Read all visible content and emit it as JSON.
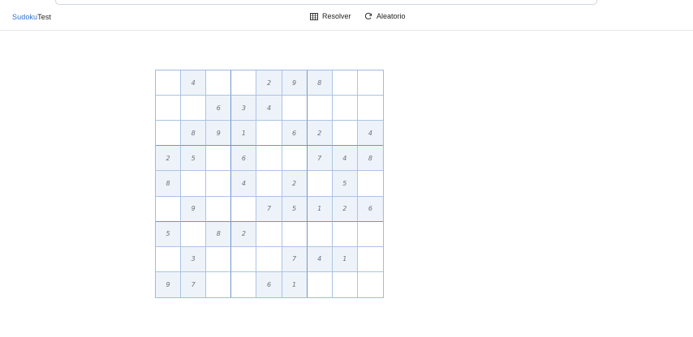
{
  "brand": {
    "part1": "Sudoku",
    "part2": "Test"
  },
  "nav": {
    "resolver": {
      "label": "Resolver",
      "icon": "grid-icon"
    },
    "aleatorio": {
      "label": "Aleatorio",
      "icon": "refresh-icon"
    }
  },
  "colors": {
    "brand_accent": "#2f6fd1",
    "given_cell_bg": "#eef3fa",
    "grid_line": "#aac4e4",
    "box_line": "#6f97c8"
  },
  "board": {
    "rows": [
      [
        "",
        "4",
        "",
        "",
        "2",
        "9",
        "8",
        "",
        ""
      ],
      [
        "",
        "",
        "6",
        "3",
        "4",
        "",
        "",
        "",
        ""
      ],
      [
        "",
        "8",
        "9",
        "1",
        "",
        "6",
        "2",
        "",
        "4"
      ],
      [
        "2",
        "5",
        "",
        "6",
        "",
        "",
        "7",
        "4",
        "8"
      ],
      [
        "8",
        "",
        "",
        "4",
        "",
        "2",
        "",
        "5",
        ""
      ],
      [
        "",
        "9",
        "",
        "",
        "7",
        "5",
        "1",
        "2",
        "6"
      ],
      [
        "5",
        "",
        "8",
        "2",
        "",
        "",
        "",
        "",
        ""
      ],
      [
        "",
        "3",
        "",
        "",
        "",
        "7",
        "4",
        "1",
        ""
      ],
      [
        "9",
        "7",
        "",
        "",
        "6",
        "1",
        "",
        "",
        ""
      ]
    ]
  }
}
